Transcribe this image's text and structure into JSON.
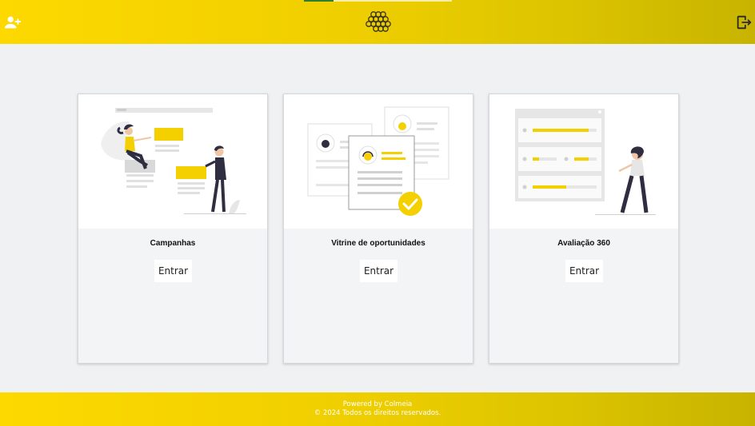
{
  "header": {
    "add_user_icon": "add-user-icon",
    "logo_icon": "honeycomb-logo-icon",
    "logout_icon": "logout-icon",
    "progress": 0.2,
    "colors": {
      "gradient_start": "#fdd900",
      "gradient_end": "#c8b400",
      "progress": "#2e7d32"
    }
  },
  "cards": [
    {
      "title": "Campanhas",
      "button_label": "Entrar",
      "illustration": "campaign-illustration"
    },
    {
      "title": "Vitrine de oportunidades",
      "button_label": "Entrar",
      "illustration": "opportunities-illustration"
    },
    {
      "title": "Avaliação 360",
      "button_label": "Entrar",
      "illustration": "evaluation-illustration"
    }
  ],
  "footer": {
    "powered_by": "Powered by Colmeia",
    "copyright": "© 2024 Todos os direitos reservados."
  },
  "colors": {
    "accent": "#f5d000",
    "dark": "#2f2e41",
    "background": "#f0f1f3"
  }
}
